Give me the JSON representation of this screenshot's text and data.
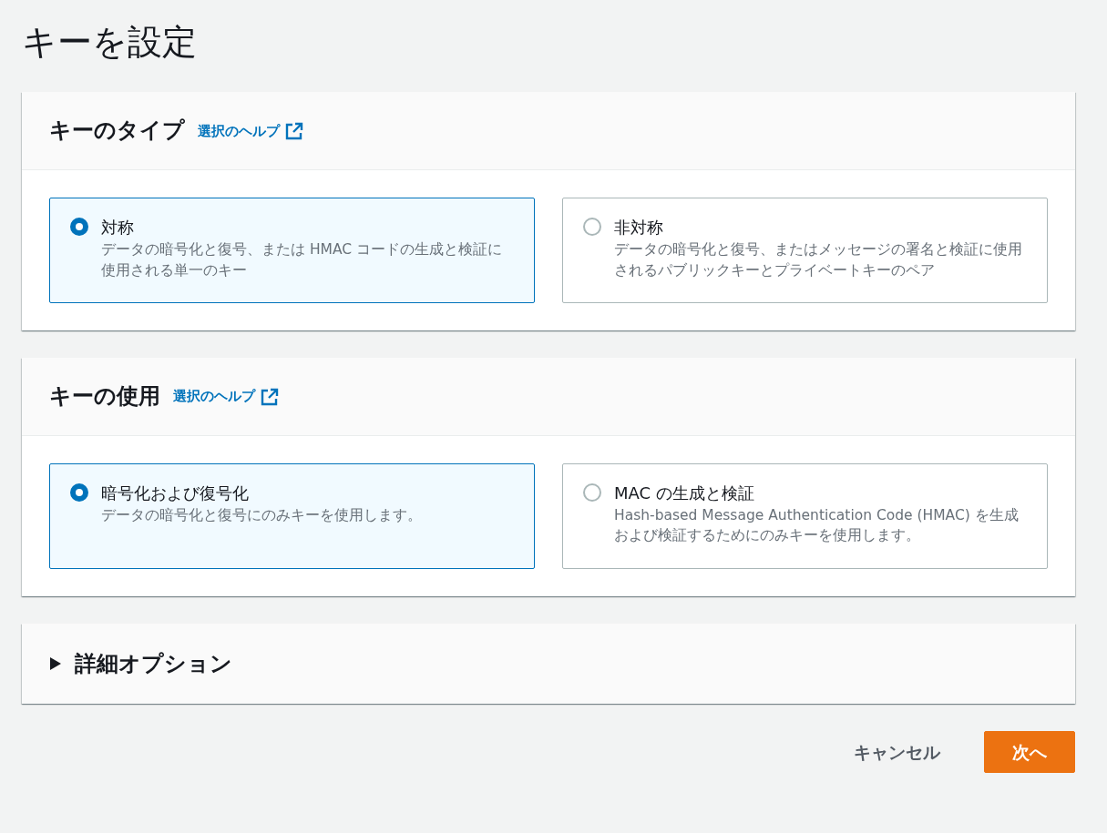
{
  "page_title": "キーを設定",
  "sections": [
    {
      "kind": "radio-group",
      "title": "キーのタイプ",
      "help_link": "選択のヘルプ",
      "options": [
        {
          "label": "対称",
          "description": "データの暗号化と復号、または HMAC コードの生成と検証に使用される単一のキー",
          "selected": true
        },
        {
          "label": "非対称",
          "description": "データの暗号化と復号、またはメッセージの署名と検証に使用されるパブリックキーとプライベートキーのペア",
          "selected": false
        }
      ]
    },
    {
      "kind": "radio-group",
      "title": "キーの使用",
      "help_link": "選択のヘルプ",
      "options": [
        {
          "label": "暗号化および復号化",
          "description": "データの暗号化と復号にのみキーを使用します。",
          "selected": true
        },
        {
          "label": "MAC の生成と検証",
          "description": "Hash-based Message Authentication Code (HMAC) を生成および検証するためにのみキーを使用します。",
          "selected": false
        }
      ]
    },
    {
      "kind": "expander",
      "title": "詳細オプション",
      "expanded": false
    }
  ],
  "buttons": [
    {
      "label": "キャンセル",
      "kind": "link"
    },
    {
      "label": "次へ",
      "kind": "primary"
    }
  ]
}
